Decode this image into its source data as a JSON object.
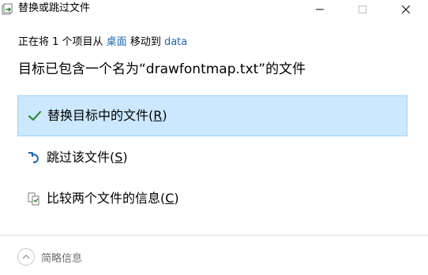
{
  "window": {
    "title": "替换或跳过文件"
  },
  "info": {
    "prefix": "正在将 1 个项目从 ",
    "source": "桌面",
    "middle": " 移动到 ",
    "destination": "data"
  },
  "heading": "目标已包含一个名为“drawfontmap.txt”的文件",
  "options": {
    "replace": {
      "label": "替换目标中的文件(",
      "key": "R",
      "suffix": ")"
    },
    "skip": {
      "label": "跳过该文件(",
      "key": "S",
      "suffix": ")"
    },
    "compare": {
      "label": "比较两个文件的信息(",
      "key": "C",
      "suffix": ")"
    }
  },
  "footer": {
    "details_label": "简略信息"
  },
  "colors": {
    "link": "#1a66b3",
    "selected_bg": "#cce8ff",
    "selected_border": "#99d1ff",
    "check": "#2e8b3d",
    "skip_icon": "#1a66b3"
  },
  "icons": {
    "app": "move-file-icon",
    "minimize": "minimize-icon",
    "maximize": "maximize-icon",
    "close": "close-icon",
    "replace": "checkmark-icon",
    "skip": "skip-arrow-icon",
    "compare": "compare-files-icon",
    "details": "chevron-up-icon"
  }
}
